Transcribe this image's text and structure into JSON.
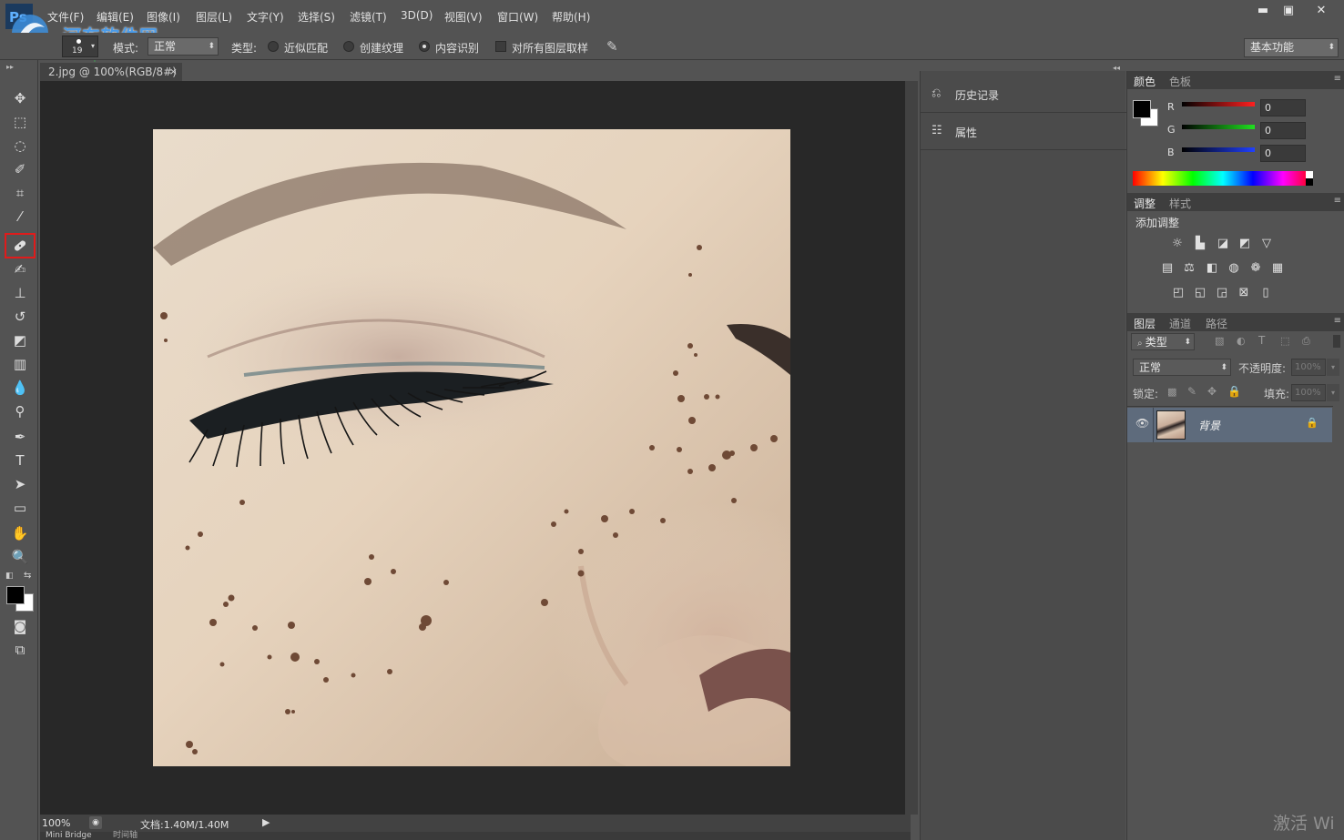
{
  "menu": {
    "items": [
      "文件(F)",
      "编辑(E)",
      "图像(I)",
      "图层(L)",
      "文字(Y)",
      "选择(S)",
      "滤镜(T)",
      "3D(D)",
      "视图(V)",
      "窗口(W)",
      "帮助(H)"
    ]
  },
  "watermark": {
    "name": "河东软件网",
    "url": "www.pc0359.cn"
  },
  "options": {
    "brush_size": "19",
    "mode_label": "模式:",
    "mode_value": "正常",
    "type_label": "类型:",
    "type_options": [
      "近似匹配",
      "创建纹理",
      "内容识别"
    ],
    "type_selected": "内容识别",
    "sample_all_label": "对所有图层取样",
    "workspace": "基本功能"
  },
  "document": {
    "tab_title": "2.jpg @ 100%(RGB/8#)",
    "zoom": "100%",
    "doc_size": "文档:1.40M/1.40M",
    "bottom_tabs": [
      "Mini Bridge",
      "时间轴"
    ]
  },
  "mid_panel": {
    "items": [
      {
        "label": "历史记录",
        "icon": "history-icon"
      },
      {
        "label": "属性",
        "icon": "properties-icon"
      }
    ]
  },
  "color_panel": {
    "tabs": [
      "颜色",
      "色板"
    ],
    "channels": [
      {
        "label": "R",
        "value": "0",
        "color": "#e02020"
      },
      {
        "label": "G",
        "value": "0",
        "color": "#20c020"
      },
      {
        "label": "B",
        "value": "0",
        "color": "#2040e0"
      }
    ]
  },
  "adjust_panel": {
    "tabs": [
      "调整",
      "样式"
    ],
    "title": "添加调整"
  },
  "layers_panel": {
    "tabs": [
      "图层",
      "通道",
      "路径"
    ],
    "filter_label": "类型",
    "blend_mode": "正常",
    "opacity_label": "不透明度:",
    "opacity_value": "100%",
    "lock_label": "锁定:",
    "fill_label": "填充:",
    "fill_value": "100%",
    "layers": [
      {
        "name": "背景"
      }
    ]
  },
  "activation_text": "激活 Wi",
  "colors": {
    "highlight_red": "#e01b1b",
    "selected_layer": "#5e6b7c",
    "panel_bg": "#535353",
    "canvas_bg": "#282828"
  }
}
